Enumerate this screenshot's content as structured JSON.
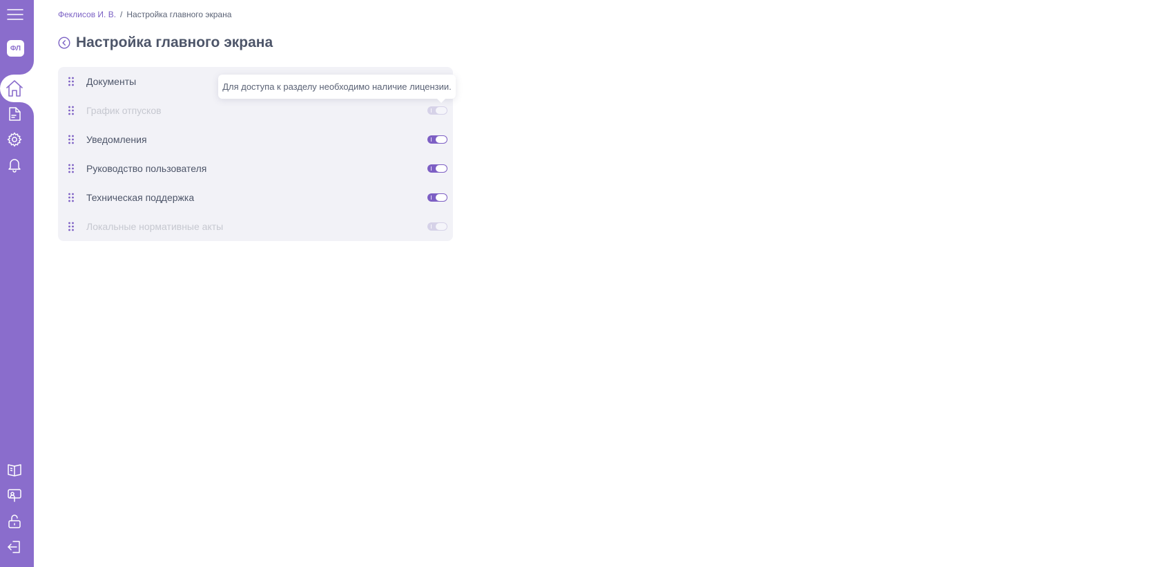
{
  "sidebar": {
    "avatar_initials": "ФЛ",
    "accent_color": "#8a6dcc",
    "top_icons": [
      "menu-icon",
      "home-icon",
      "document-icon",
      "gear-icon",
      "bell-icon"
    ],
    "bottom_icons": [
      "book-icon",
      "presentation-icon",
      "lock-open-icon",
      "logout-icon"
    ]
  },
  "breadcrumb": {
    "parent": "Феклисов И. В.",
    "separator": "/",
    "current": "Настройка главного экрана"
  },
  "page": {
    "title": "Настройка главного экрана"
  },
  "sections": [
    {
      "label": "Документы",
      "enabled": true,
      "disabled": false
    },
    {
      "label": "График отпусков",
      "enabled": true,
      "disabled": true
    },
    {
      "label": "Уведомления",
      "enabled": true,
      "disabled": false
    },
    {
      "label": "Руководство пользователя",
      "enabled": true,
      "disabled": false
    },
    {
      "label": "Техническая поддержка",
      "enabled": true,
      "disabled": false
    },
    {
      "label": "Локальные нормативные акты",
      "enabled": true,
      "disabled": true
    }
  ],
  "tooltip": {
    "text": "Для доступа к разделу необходимо наличие лицензии."
  }
}
